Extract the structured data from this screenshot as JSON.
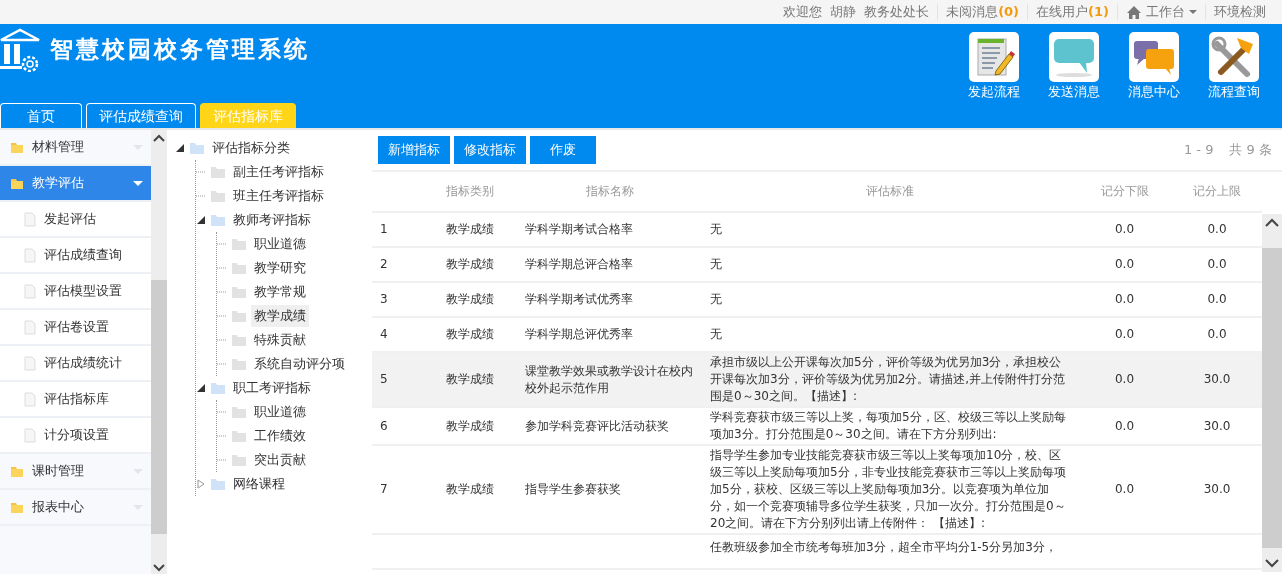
{
  "topbar": {
    "welcome": "欢迎您",
    "user": "胡静",
    "role": "教务处处长",
    "unread_label": "未阅消息",
    "unread_count": "(0)",
    "online_label": "在线用户",
    "online_count": "(1)",
    "workbench": "工作台",
    "env_check": "环境检测"
  },
  "header": {
    "title": "智慧校园校务管理系统",
    "quick_actions": [
      {
        "label": "发起流程",
        "kind": "document"
      },
      {
        "label": "发送消息",
        "kind": "bubble"
      },
      {
        "label": "消息中心",
        "kind": "bubbles"
      },
      {
        "label": "流程查询",
        "kind": "tools"
      }
    ]
  },
  "tabs": [
    {
      "label": "首页",
      "selected": false
    },
    {
      "label": "评估成绩查询",
      "selected": false
    },
    {
      "label": "评估指标库",
      "selected": true
    }
  ],
  "sidebar": {
    "items": [
      {
        "label": "材料管理",
        "selected": false,
        "expanded": false
      },
      {
        "label": "教学评估",
        "selected": true,
        "expanded": true,
        "children": [
          {
            "label": "发起评估"
          },
          {
            "label": "评估成绩查询"
          },
          {
            "label": "评估模型设置"
          },
          {
            "label": "评估卷设置"
          },
          {
            "label": "评估成绩统计"
          },
          {
            "label": "评估指标库"
          },
          {
            "label": "计分项设置"
          }
        ]
      },
      {
        "label": "课时管理",
        "selected": false,
        "expanded": false
      },
      {
        "label": "报表中心",
        "selected": false,
        "expanded": false
      }
    ]
  },
  "tree": {
    "label": "评估指标分类",
    "expanded": true,
    "selected": false,
    "children": [
      {
        "label": "副主任考评指标",
        "selected": false
      },
      {
        "label": "班主任考评指标",
        "selected": false
      },
      {
        "label": "教师考评指标",
        "expanded": true,
        "selected": false,
        "children": [
          {
            "label": "职业道德",
            "selected": false
          },
          {
            "label": "教学研究",
            "selected": false
          },
          {
            "label": "教学常规",
            "selected": false
          },
          {
            "label": "教学成绩",
            "selected": true
          },
          {
            "label": "特殊贡献",
            "selected": false
          },
          {
            "label": "系统自动评分项",
            "selected": false
          }
        ]
      },
      {
        "label": "职工考评指标",
        "expanded": true,
        "selected": false,
        "children": [
          {
            "label": "职业道德",
            "selected": false
          },
          {
            "label": "工作绩效",
            "selected": false
          },
          {
            "label": "突出贡献",
            "selected": false
          }
        ]
      },
      {
        "label": "网络课程",
        "expanded": false,
        "selected": false
      }
    ]
  },
  "toolbar": {
    "buttons": [
      "新增指标",
      "修改指标",
      "作废"
    ]
  },
  "pagination": {
    "range": "1 - 9",
    "total": "共 9 条"
  },
  "table": {
    "columns": [
      "指标类别",
      "指标名称",
      "评估标准",
      "记分下限",
      "记分上限"
    ],
    "rows": [
      {
        "index": "1",
        "category": "教学成绩",
        "name": "学科学期考试合格率",
        "criteria": "无",
        "min": "0.0",
        "max": "0.0",
        "selected": false
      },
      {
        "index": "2",
        "category": "教学成绩",
        "name": "学科学期总评合格率",
        "criteria": "无",
        "min": "0.0",
        "max": "0.0",
        "selected": false
      },
      {
        "index": "3",
        "category": "教学成绩",
        "name": "学科学期考试优秀率",
        "criteria": "无",
        "min": "0.0",
        "max": "0.0",
        "selected": false
      },
      {
        "index": "4",
        "category": "教学成绩",
        "name": "学科学期总评优秀率",
        "criteria": "无",
        "min": "0.0",
        "max": "0.0",
        "selected": false
      },
      {
        "index": "5",
        "category": "教学成绩",
        "name": "课堂教学效果或教学设计在校内校外起示范作用",
        "criteria": "承担市级以上公开课每次加5分，评价等级为优另加3分，承担校公开课每次加3分，评价等级为优另加2分。请描述,并上传附件打分范围是0～30之间。【描述】:",
        "min": "0.0",
        "max": "30.0",
        "selected": true
      },
      {
        "index": "6",
        "category": "教学成绩",
        "name": "参加学科竞赛评比活动获奖",
        "criteria": "学科竞赛获市级三等以上奖，每项加5分，区、校级三等以上奖励每项加3分。打分范围是0～30之间。请在下方分别列出:",
        "min": "0.0",
        "max": "30.0",
        "selected": false
      },
      {
        "index": "7",
        "category": "教学成绩",
        "name": "指导学生参赛获奖",
        "criteria": "指导学生参加专业技能竞赛获市级三等以上奖每项加10分，校、区级三等以上奖励每项加5分，非专业技能竞赛获市三等以上奖励每项加5分，获校、区级三等以上奖励每项加3分。以竞赛项为单位加分，如一个竞赛项辅导多位学生获奖，只加一次分。打分范围是0～20之间。请在下方分别列出请上传附件： 【描述】:",
        "min": "0.0",
        "max": "30.0",
        "selected": false
      },
      {
        "criteria": "任教班级参加全市统考每班加3分，超全市平均分1-5分另加3分，",
        "selected": false
      }
    ]
  }
}
